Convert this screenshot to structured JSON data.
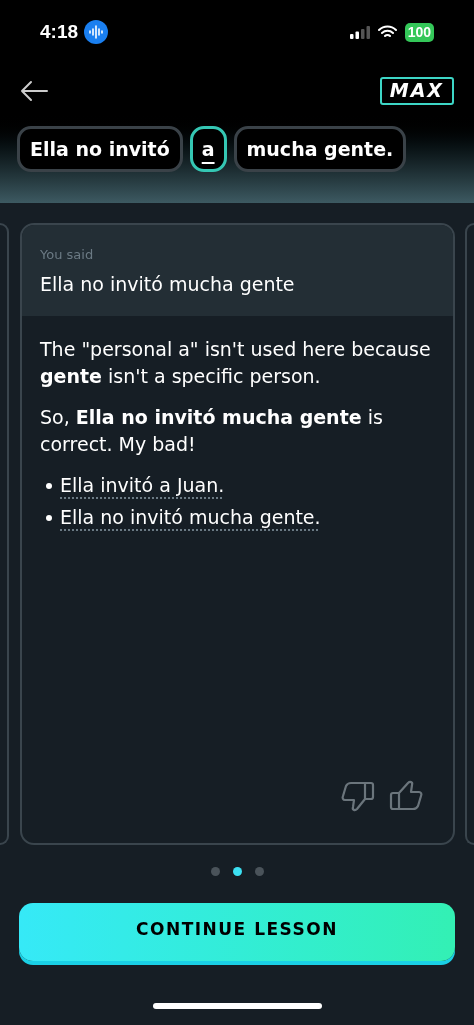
{
  "status_bar": {
    "time": "4:18",
    "battery": "100"
  },
  "header": {
    "badge": "MAX"
  },
  "sentence": [
    {
      "text": "Ella no invitó",
      "selected": false
    },
    {
      "text": "a",
      "selected": true
    },
    {
      "text": "mucha gente.",
      "selected": false
    }
  ],
  "card": {
    "label": "You said",
    "transcript": "Ella no invitó mucha gente",
    "paragraphs": [
      "The \"personal a\" isn't used here because **gente** isn't a specific person.",
      "So, **Ella no invitó mucha gente** is correct. My bad!"
    ],
    "examples": [
      "Ella invitó a Juan.",
      "Ella no invitó mucha gente."
    ]
  },
  "pager": [
    {
      "selected": false
    },
    {
      "selected": true
    },
    {
      "selected": false
    }
  ],
  "button": "CONTINUE LESSON"
}
